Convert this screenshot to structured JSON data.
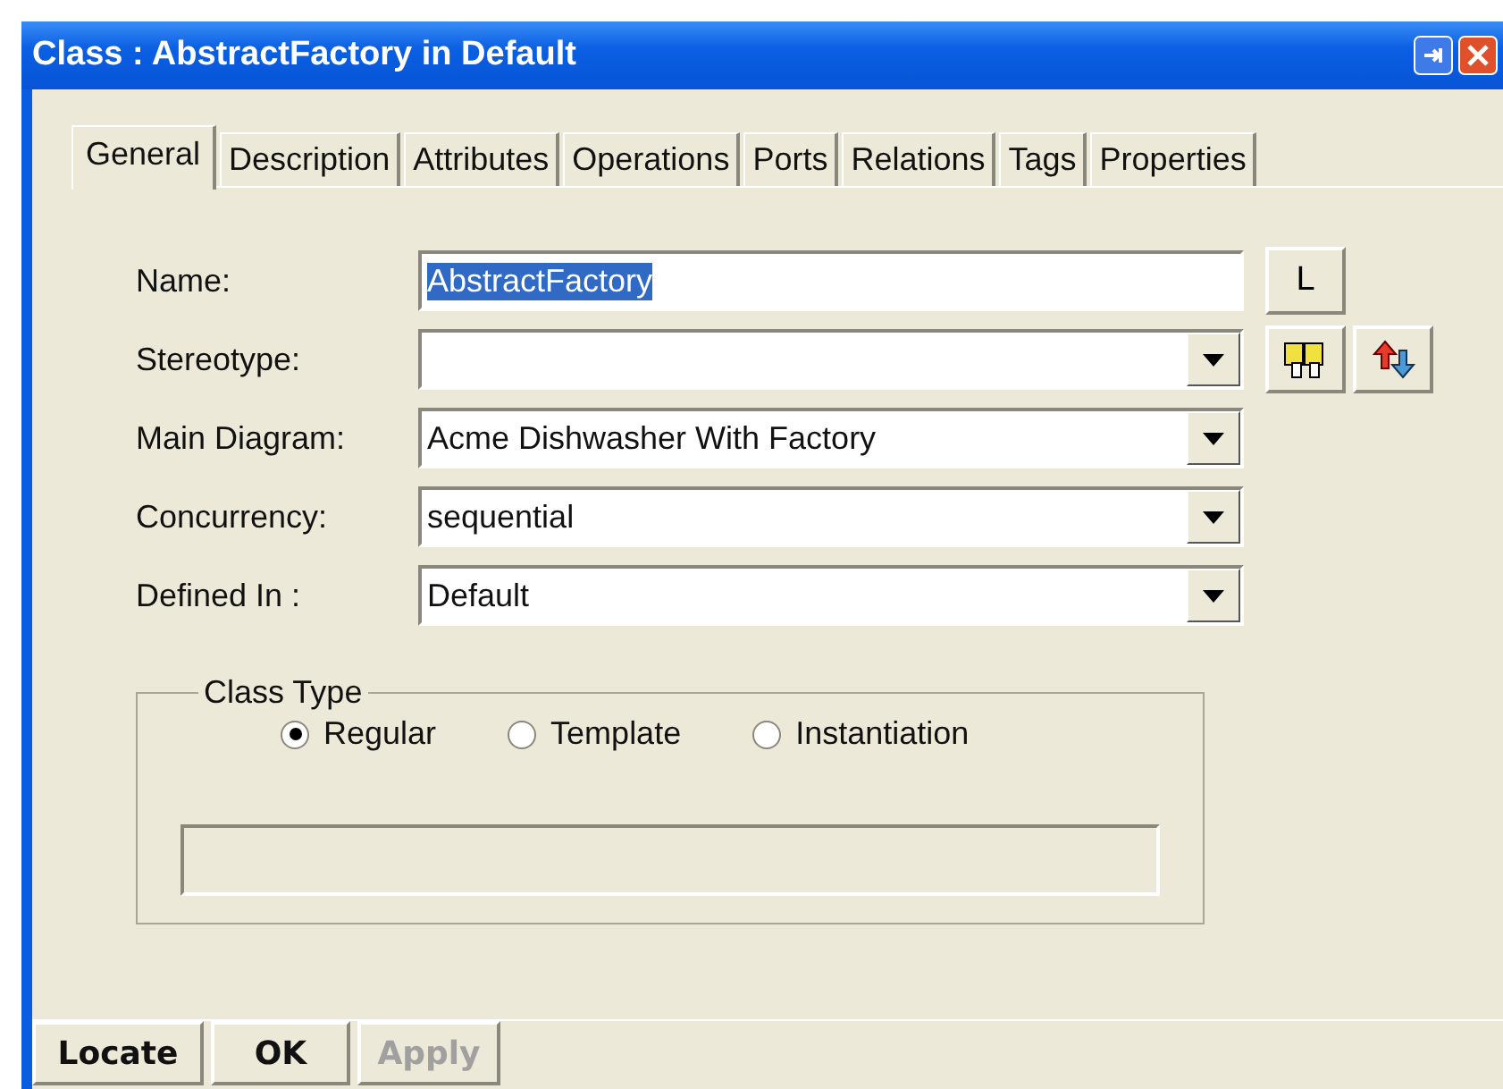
{
  "window": {
    "title": "Class : AbstractFactory in Default"
  },
  "tabs": [
    {
      "label": "General",
      "selected": true
    },
    {
      "label": "Description",
      "selected": false
    },
    {
      "label": "Attributes",
      "selected": false
    },
    {
      "label": "Operations",
      "selected": false
    },
    {
      "label": "Ports",
      "selected": false
    },
    {
      "label": "Relations",
      "selected": false
    },
    {
      "label": "Tags",
      "selected": false
    },
    {
      "label": "Properties",
      "selected": false
    }
  ],
  "fields": [
    {
      "label": "Name:",
      "kind": "text",
      "value": "AbstractFactory",
      "selected": true
    },
    {
      "label": "Stereotype:",
      "kind": "combo"
    },
    {
      "label": "Main Diagram:",
      "kind": "combo",
      "value": "Acme Dishwasher With Factory"
    },
    {
      "label": "Concurrency:",
      "kind": "combo",
      "value": "sequential"
    },
    {
      "label": "Defined In :",
      "kind": "combo",
      "value": "Default"
    }
  ],
  "label_button": "L",
  "class_type": {
    "title": "Class Type",
    "options": [
      {
        "label": "Regular",
        "selected": true
      },
      {
        "label": "Template",
        "selected": false
      },
      {
        "label": "Instantiation",
        "selected": false
      }
    ]
  },
  "buttons": [
    {
      "label": "Locate",
      "disabled": false
    },
    {
      "label": "OK",
      "disabled": false
    },
    {
      "label": "Apply",
      "disabled": true
    }
  ]
}
